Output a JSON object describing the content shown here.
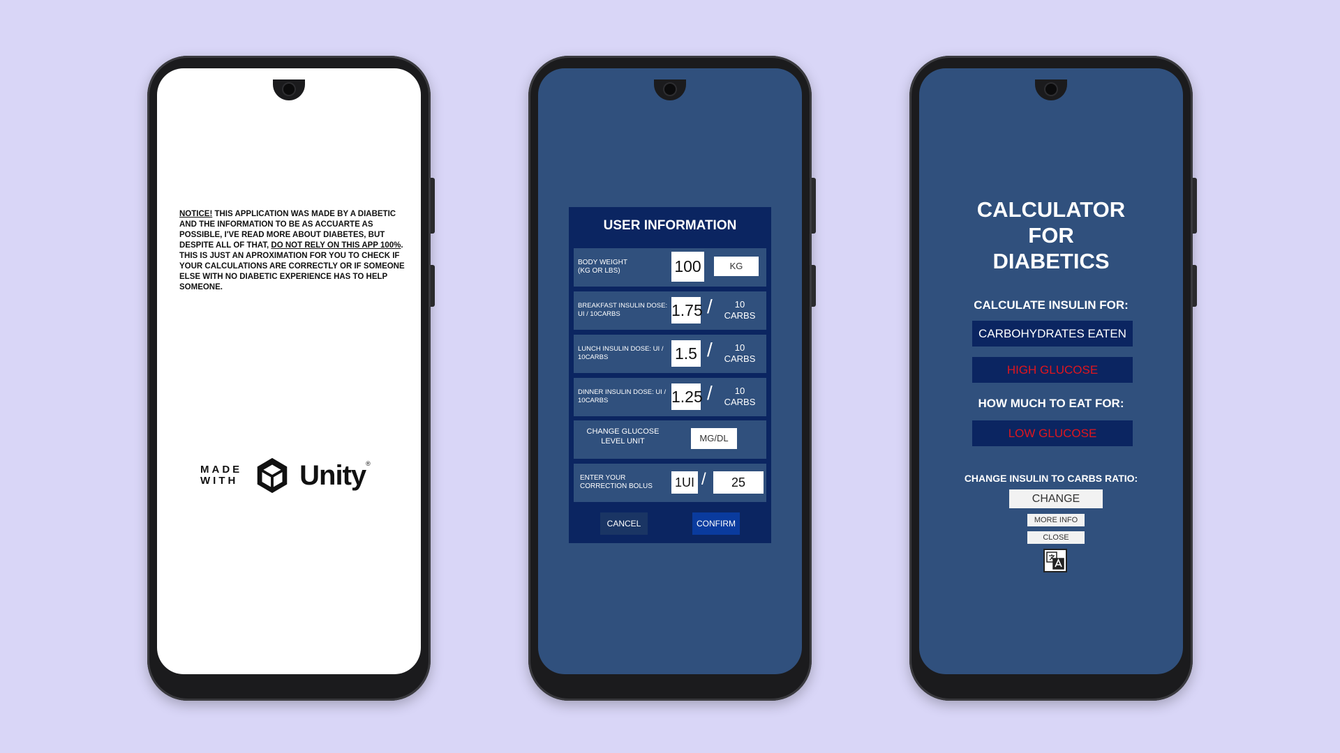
{
  "phone1": {
    "notice_lead": "NOTICE!",
    "notice_text": " THIS APPLICATION WAS MADE BY A DIABETIC AND THE INFORMATION TO BE AS ACCUARTE AS POSSIBLE, I'VE READ MORE ABOUT DIABETES, BUT DESPITE ALL OF THAT, ",
    "notice_emphasis": "DO NOT RELY ON THIS APP 100%",
    "notice_tail": ". THIS IS JUST AN APROXIMATION FOR YOU TO CHECK IF YOUR CALCULATIONS ARE CORRECTLY OR IF SOMEONE ELSE WITH NO DIABETIC EXPERIENCE HAS TO HELP SOMEONE.",
    "made_line1": "MADE",
    "made_line2": "WITH",
    "unity_word": "Unity",
    "unity_reg": "®"
  },
  "phone2": {
    "title": "USER INFORMATION",
    "body_weight": {
      "label1": "BODY WEIGHT",
      "label2": "(KG OR LBS)",
      "value": "100",
      "unit": "KG"
    },
    "breakfast": {
      "label1": "BREAKFAST INSULIN DOSE:",
      "label2": "UI / 10CARBS",
      "value": "1.75",
      "carbs1": "10",
      "carbs2": "CARBS"
    },
    "lunch": {
      "label1": "LUNCH INSULIN DOSE: UI /",
      "label2": "10CARBS",
      "value": "1.5",
      "carbs1": "10",
      "carbs2": "CARBS"
    },
    "dinner": {
      "label1": "DINNER INSULIN DOSE: UI /",
      "label2": "10CARBS",
      "value": "1.25",
      "carbs1": "10",
      "carbs2": "CARBS"
    },
    "glucose": {
      "label1": "CHANGE GLUCOSE",
      "label2": "LEVEL UNIT",
      "unit": "MG/DL"
    },
    "correction": {
      "label1": "ENTER YOUR",
      "label2": "CORRECTION BOLUS",
      "value1": "1UI",
      "value2": "25"
    },
    "slash": "/",
    "cancel": "CANCEL",
    "confirm": "CONFIRM"
  },
  "phone3": {
    "title1": "CALCULATOR",
    "title2": "FOR",
    "title3": "DIABETICS",
    "calc_insulin_for": "CALCULATE INSULIN FOR:",
    "carbs_eaten": "CARBOHYDRATES EATEN",
    "high_glucose": "HIGH GLUCOSE",
    "how_much_eat": "HOW MUCH TO EAT FOR:",
    "low_glucose": "LOW GLUCOSE",
    "change_ratio": "CHANGE INSULIN TO CARBS RATIO:",
    "change": "CHANGE",
    "more_info": "MORE INFO",
    "close": "CLOSE"
  },
  "colors": {
    "background": "#d9d6f7",
    "screen_blue": "#30507d",
    "dark_navy": "#0b2561",
    "confirm_blue": "#0a3b9e",
    "alert_red": "#e0161e"
  }
}
